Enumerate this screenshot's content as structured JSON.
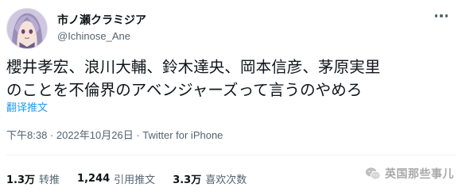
{
  "author": {
    "display_name": "市ノ瀬クラミジア",
    "handle": "@Ichinose_Ane"
  },
  "tweet": {
    "line1": "櫻井孝宏、浪川大輔、鈴木達央、岡本信彦、茅原実里",
    "line2": "のことを不倫界のアベンジャーズって言うのやめろ",
    "translate_label": "翻译推文",
    "timestamp": "下午8:38 · 2022年10月26日 · ",
    "source_app": "Twitter for iPhone"
  },
  "stats": [
    {
      "count": "1.3万",
      "label": "转推"
    },
    {
      "count": "1,244",
      "label": "引用推文"
    },
    {
      "count": "3.3万",
      "label": "喜欢次数"
    }
  ],
  "watermark": {
    "text": "英国那些事儿",
    "icon": "wechat-icon"
  },
  "icons": {
    "more": "more-dots-icon"
  }
}
